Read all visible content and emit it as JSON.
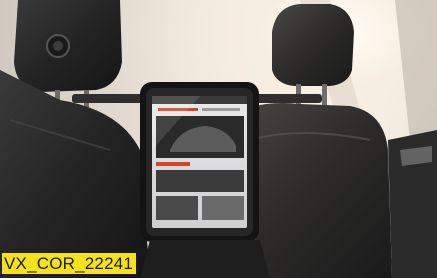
{
  "photo": {
    "code_label": "VX_COR_22241"
  },
  "colors": {
    "label_background": "#f5e21b",
    "label_text": "#1b1b1b",
    "seat_leather": "#2b2b2b",
    "window_light": "#f4ece0",
    "tablet_accent": "#d2462c"
  }
}
